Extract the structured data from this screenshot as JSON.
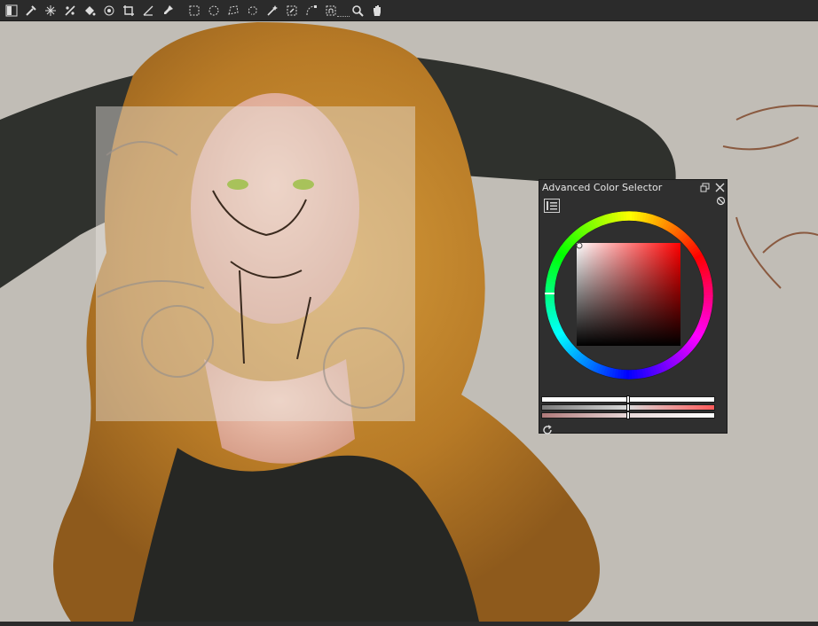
{
  "toolbar": {
    "tools": [
      {
        "name": "gradient-tool-icon"
      },
      {
        "name": "eyedropper-tool-icon"
      },
      {
        "name": "smart-patch-tool-icon"
      },
      {
        "name": "assistant-tool-icon"
      },
      {
        "name": "fill-tool-icon"
      },
      {
        "name": "reference-tool-icon"
      },
      {
        "name": "crop-tool-icon"
      },
      {
        "name": "measure-tool-icon"
      },
      {
        "name": "pin-tool-icon"
      },
      {
        "name": "rectangular-selection-icon"
      },
      {
        "name": "elliptical-selection-icon"
      },
      {
        "name": "polygonal-selection-icon"
      },
      {
        "name": "freehand-selection-icon"
      },
      {
        "name": "magic-wand-selection-icon"
      },
      {
        "name": "similar-color-selection-icon"
      },
      {
        "name": "bezier-selection-icon"
      },
      {
        "name": "magnetic-selection-icon"
      },
      {
        "name": "zoom-tool-icon"
      },
      {
        "name": "pan-tool-icon"
      }
    ]
  },
  "docker": {
    "title": "Advanced Color Selector",
    "colors": {
      "hue": "#ff0000",
      "selected": "#c2a8a8"
    },
    "icons": {
      "float": "float-docker-icon",
      "close": "close-icon",
      "disable": "disable-icon",
      "settings": "settings-list-icon",
      "refresh": "refresh-icon"
    }
  }
}
